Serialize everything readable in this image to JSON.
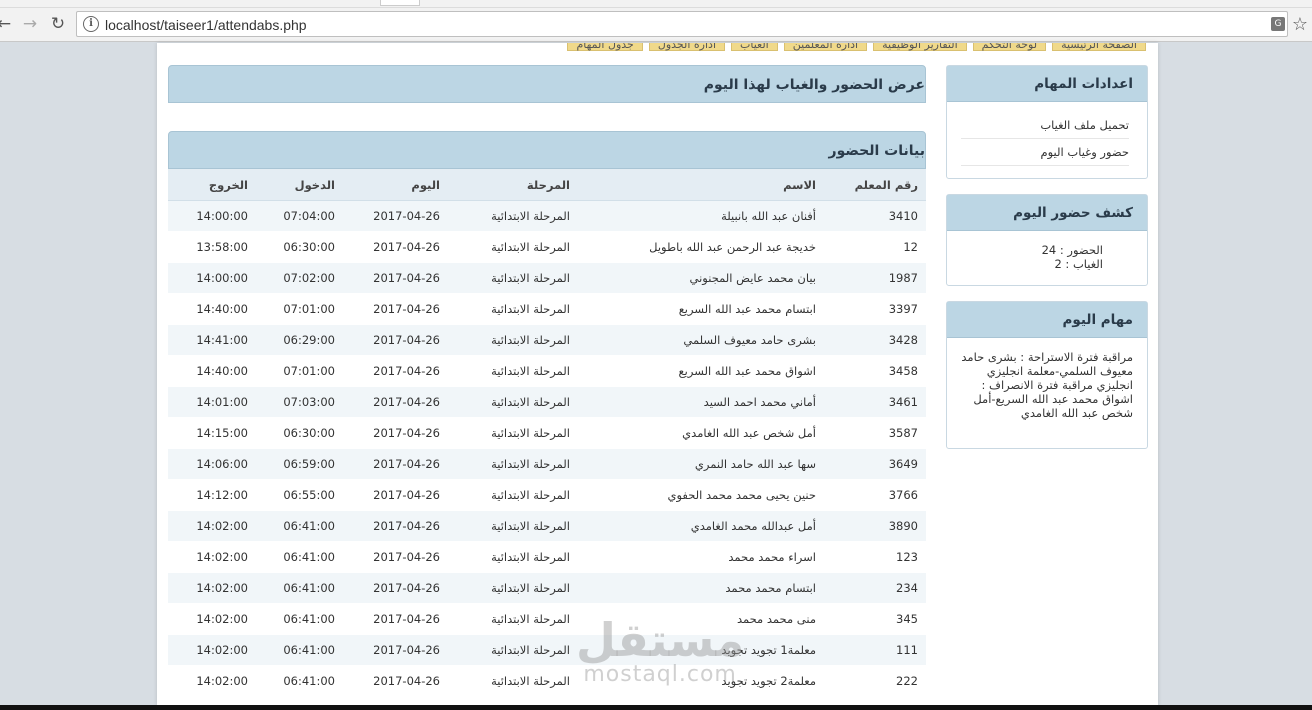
{
  "browser": {
    "url": "localhost/taiseer1/attendabs.php"
  },
  "menu": [
    "الصفحة الرئيسية",
    "لوحة التحكم",
    "التقارير الوظيفية",
    "ادارة المعلمين",
    "الغياب",
    "ادارة الجدول",
    "جدول المهام"
  ],
  "sidebar": {
    "settings": {
      "title": "اعدادات المهام",
      "links": [
        "تحميل ملف الغياب",
        "حضور وغياب اليوم"
      ]
    },
    "attendance": {
      "title": "كشف حضور اليوم",
      "present": "الحضور : 24",
      "absent": "الغياب : 2"
    },
    "tasks": {
      "title": "مهام اليوم",
      "text": "مراقبة فترة الاستراحة : بشرى حامد معيوف السلمي-معلمة انجليزي انجليزي مراقبة فترة الانصراف : اشواق محمد عبد الله السريع-أمل شخص عبد الله الغامدي"
    }
  },
  "main": {
    "title": "عرض الحضور والغياب لهذا اليوم",
    "section_title": "بيانات الحضور",
    "columns": {
      "id": "رقم المعلم",
      "name": "الاسم",
      "stage": "المرحلة",
      "day": "اليوم",
      "in": "الدخول",
      "out": "الخروج"
    },
    "rows": [
      {
        "id": "3410",
        "name": "أفنان عبد الله بانبيلة",
        "stage": "المرحلة الابتدائية",
        "day": "2017-04-26",
        "in": "07:04:00",
        "out": "14:00:00"
      },
      {
        "id": "12",
        "name": "خديجة عبد الرحمن عبد الله باطويل",
        "stage": "المرحلة الابتدائية",
        "day": "2017-04-26",
        "in": "06:30:00",
        "out": "13:58:00"
      },
      {
        "id": "1987",
        "name": "بيان محمد عايض المجنوني",
        "stage": "المرحلة الابتدائية",
        "day": "2017-04-26",
        "in": "07:02:00",
        "out": "14:00:00"
      },
      {
        "id": "3397",
        "name": "ابتسام محمد عبد الله السريع",
        "stage": "المرحلة الابتدائية",
        "day": "2017-04-26",
        "in": "07:01:00",
        "out": "14:40:00"
      },
      {
        "id": "3428",
        "name": "بشرى حامد معيوف السلمي",
        "stage": "المرحلة الابتدائية",
        "day": "2017-04-26",
        "in": "06:29:00",
        "out": "14:41:00"
      },
      {
        "id": "3458",
        "name": "اشواق محمد عبد الله السريع",
        "stage": "المرحلة الابتدائية",
        "day": "2017-04-26",
        "in": "07:01:00",
        "out": "14:40:00"
      },
      {
        "id": "3461",
        "name": "أماني محمد احمد السيد",
        "stage": "المرحلة الابتدائية",
        "day": "2017-04-26",
        "in": "07:03:00",
        "out": "14:01:00"
      },
      {
        "id": "3587",
        "name": "أمل شخص عبد الله الغامدي",
        "stage": "المرحلة الابتدائية",
        "day": "2017-04-26",
        "in": "06:30:00",
        "out": "14:15:00"
      },
      {
        "id": "3649",
        "name": "سها عبد الله حامد النمري",
        "stage": "المرحلة الابتدائية",
        "day": "2017-04-26",
        "in": "06:59:00",
        "out": "14:06:00"
      },
      {
        "id": "3766",
        "name": "حنين يحيى محمد محمد الحفوي",
        "stage": "المرحلة الابتدائية",
        "day": "2017-04-26",
        "in": "06:55:00",
        "out": "14:12:00"
      },
      {
        "id": "3890",
        "name": "أمل عبدالله محمد الغامدي",
        "stage": "المرحلة الابتدائية",
        "day": "2017-04-26",
        "in": "06:41:00",
        "out": "14:02:00"
      },
      {
        "id": "123",
        "name": "اسراء محمد محمد",
        "stage": "المرحلة الابتدائية",
        "day": "2017-04-26",
        "in": "06:41:00",
        "out": "14:02:00"
      },
      {
        "id": "234",
        "name": "ابتسام محمد محمد",
        "stage": "المرحلة الابتدائية",
        "day": "2017-04-26",
        "in": "06:41:00",
        "out": "14:02:00"
      },
      {
        "id": "345",
        "name": "منى محمد محمد",
        "stage": "المرحلة الابتدائية",
        "day": "2017-04-26",
        "in": "06:41:00",
        "out": "14:02:00"
      },
      {
        "id": "111",
        "name": "معلمة1 تجويد تجويد",
        "stage": "المرحلة الابتدائية",
        "day": "2017-04-26",
        "in": "06:41:00",
        "out": "14:02:00"
      },
      {
        "id": "222",
        "name": "معلمة2 تجويد تجويد",
        "stage": "المرحلة الابتدائية",
        "day": "2017-04-26",
        "in": "06:41:00",
        "out": "14:02:00"
      }
    ]
  },
  "watermark": {
    "arabic": "مستقل",
    "latin": "mostaql.com"
  }
}
